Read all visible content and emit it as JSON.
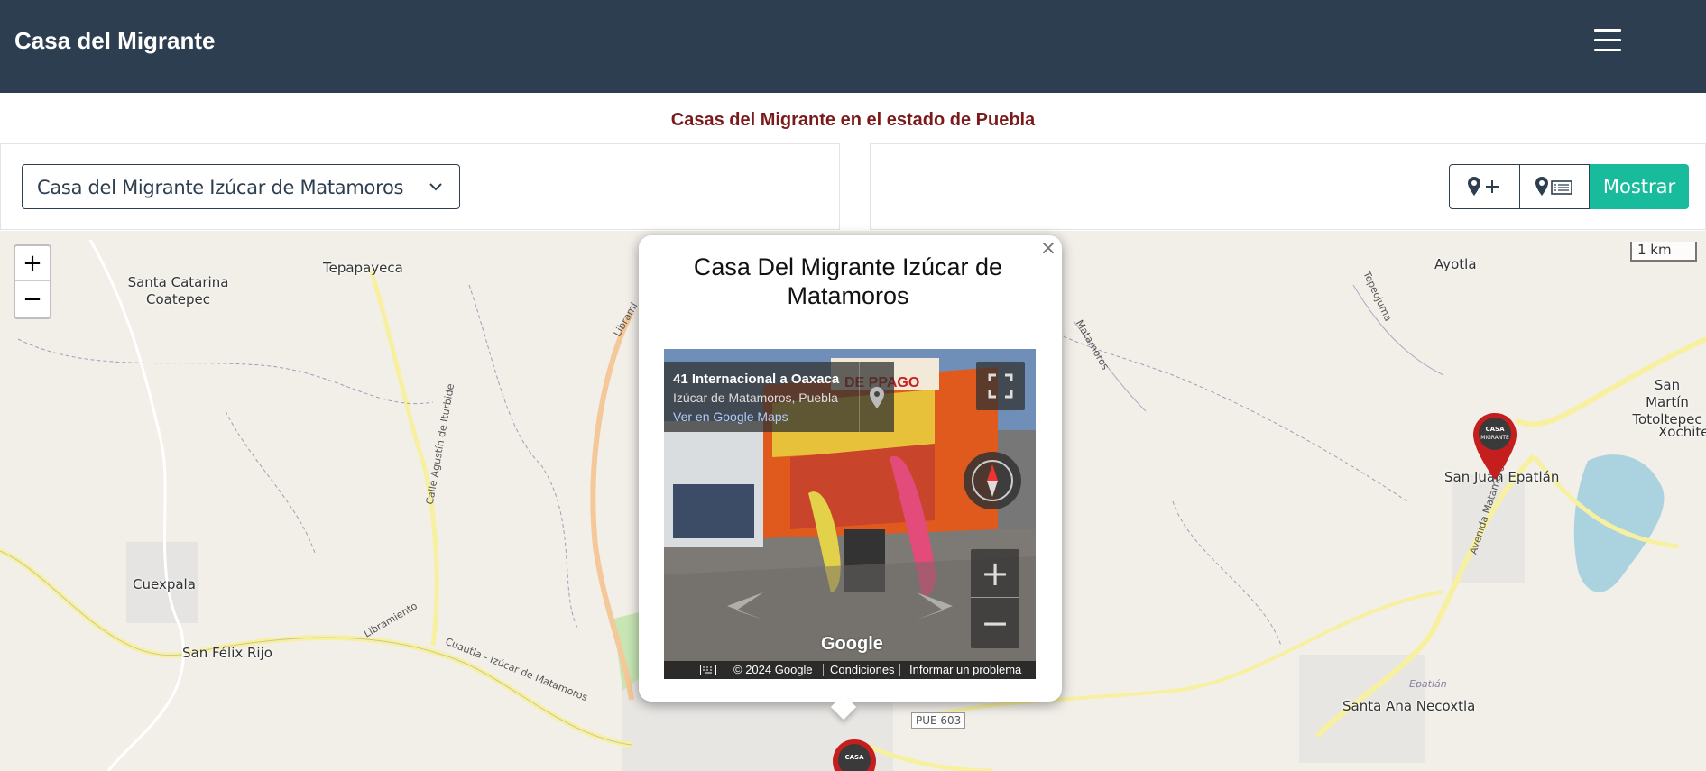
{
  "navbar": {
    "brand": "Casa del Migrante",
    "menu_icon": "hamburger-menu-icon"
  },
  "subtitle": "Casas del Migrante en el estado de Puebla",
  "selector": {
    "selected": "Casa del Migrante Izúcar de Matamoros",
    "icon": "chevron-down-icon"
  },
  "actions": {
    "add_marker_icon": "map-marker-plus-icon",
    "list_marker_icon": "map-marker-list-icon",
    "show_label": "Mostrar"
  },
  "map": {
    "zoom_in": "+",
    "zoom_out": "−",
    "scale": "1 km",
    "places": [
      "Santa Catarina Coatepec",
      "Tepapayeca",
      "Ayotla",
      "San Martín Totoltepec",
      "Xochitepec",
      "San Juan Epatlán",
      "Cuexpala",
      "San Félix Rijo",
      "Santa Ana Necoxtla"
    ],
    "roads": [
      "Librami",
      "Calle Agustín de Iturbide",
      "Libramiento",
      "Cuautla - Izúcar de Matamoros",
      "Tepeojuma",
      "Avenida Matamoros",
      "Matamoros",
      "Epatlán",
      "PUE 603"
    ],
    "marker_label": "CASA MIGRANTE"
  },
  "popup": {
    "title": "Casa Del Migrante Izúcar de Matamoros",
    "close": "×",
    "streetview": {
      "road": "41 Internacional a Oaxaca",
      "place": "Izúcar de Matamoros, Puebla",
      "link": "Ver en Google Maps",
      "sign": "DE PPAGO",
      "brand": "Google",
      "copyright": "© 2024 Google",
      "terms": "Condiciones",
      "report": "Informar un problema",
      "zoom_in": "+",
      "zoom_out": "−"
    }
  }
}
